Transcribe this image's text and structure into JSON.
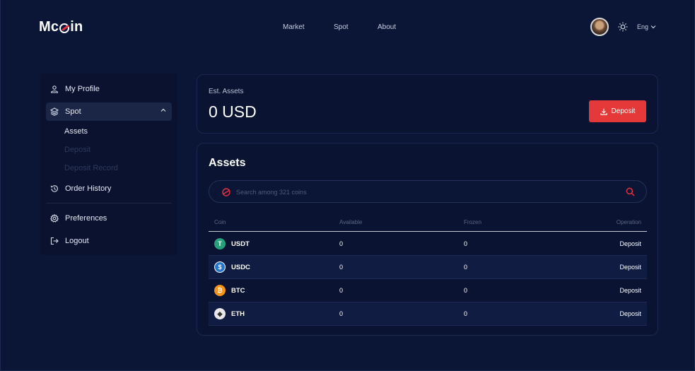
{
  "header": {
    "logo": {
      "pre": "Mc",
      "mid": "C",
      "post": "in"
    },
    "nav": [
      "Market",
      "Spot",
      "About"
    ],
    "language": "Eng"
  },
  "sidebar": {
    "items": [
      {
        "label": "My Profile",
        "icon": "user-icon"
      },
      {
        "label": "Spot",
        "icon": "layers-icon",
        "expanded": true
      },
      {
        "label": "Order History",
        "icon": "history-icon"
      },
      {
        "label": "Preferences",
        "icon": "gear-icon"
      },
      {
        "label": "Logout",
        "icon": "logout-icon"
      }
    ],
    "spot_sub": [
      "Assets",
      "Deposit",
      "Deposit Record"
    ]
  },
  "summary": {
    "label": "Est. Assets",
    "value": "0 USD",
    "deposit_label": "Deposit"
  },
  "assets": {
    "title": "Assets",
    "search_placeholder": "Search among 321 coins",
    "columns": [
      "Coin",
      "Available",
      "Frozen",
      "Operation"
    ],
    "rows": [
      {
        "coin": "USDT",
        "available": "0",
        "frozen": "0",
        "operation": "Deposit",
        "color": "#26a17b",
        "glyph": "T"
      },
      {
        "coin": "USDC",
        "available": "0",
        "frozen": "0",
        "operation": "Deposit",
        "color": "#2775ca",
        "glyph": "$"
      },
      {
        "coin": "BTC",
        "available": "0",
        "frozen": "0",
        "operation": "Deposit",
        "color": "#f7931a",
        "glyph": "₿"
      },
      {
        "coin": "ETH",
        "available": "0",
        "frozen": "0",
        "operation": "Deposit",
        "color": "#e8e8e8",
        "glyph": "◆"
      }
    ]
  },
  "colors": {
    "accent": "#e53939",
    "background": "#0b1536",
    "card": "#0a1432"
  }
}
